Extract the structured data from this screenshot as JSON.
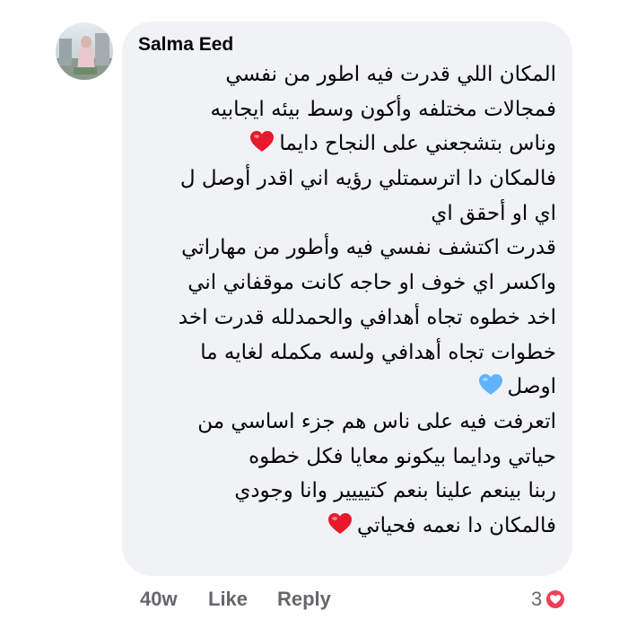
{
  "comment": {
    "author": "Salma Eed",
    "lines": [
      {
        "text": "المكان اللي قدرت فيه اطور من نفسي",
        "emoji": ""
      },
      {
        "text": "فمجالات مختلفه وأكون وسط بيئه ايجابيه",
        "emoji": ""
      },
      {
        "text": "وناس بتشجعني على النجاح دايما",
        "emoji": "red-heart"
      },
      {
        "text": "فالمكان دا اترسمتلي رؤيه اني اقدر أوصل ل",
        "emoji": ""
      },
      {
        "text": "اي او أحقق اي",
        "emoji": ""
      },
      {
        "text": "قدرت اكتشف نفسي فيه وأطور من مهاراتي",
        "emoji": ""
      },
      {
        "text": "واكسر اي خوف او حاجه كانت موقفاني اني",
        "emoji": ""
      },
      {
        "text": "اخد خطوه تجاه أهدافي والحمدلله قدرت اخد",
        "emoji": ""
      },
      {
        "text": "خطوات تجاه أهدافي ولسه مكمله لغايه ما",
        "emoji": ""
      },
      {
        "text": "اوصل",
        "emoji": "blue-heart"
      },
      {
        "text": "اتعرفت فيه على ناس هم جزء اساسي من",
        "emoji": ""
      },
      {
        "text": "حياتي ودايما بيكونو معايا فكل خطوه",
        "emoji": ""
      },
      {
        "text": "ربنا بينعم علينا بنعم كتيييير وانا وجودي",
        "emoji": ""
      },
      {
        "text": "فالمكان دا نعمه فحياتي",
        "emoji": "red-heart"
      }
    ],
    "timestamp": "40w",
    "like_label": "Like",
    "reply_label": "Reply",
    "reaction_count": "3",
    "reaction_icon": "love-reaction-icon"
  },
  "colors": {
    "bubble_background": "#f0f2f5",
    "text": "#050505",
    "secondary_text": "#65676b",
    "red_heart": "#e8192c",
    "blue_heart": "#5fb4ff",
    "love_reaction": "#f33e58"
  }
}
